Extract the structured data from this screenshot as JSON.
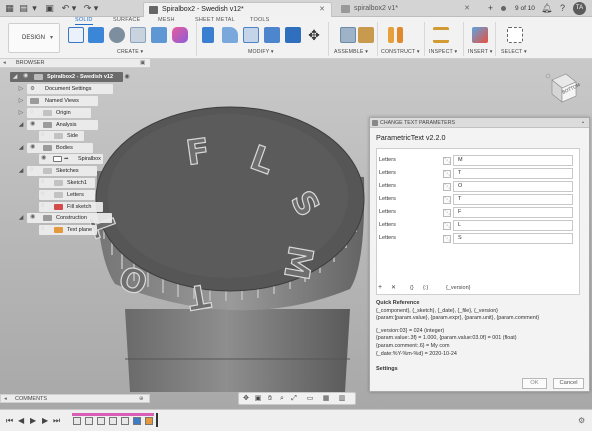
{
  "window": {
    "active_tab": "Spiralbox2 - Swedish v12*",
    "inactive_tab": "spiralbox2 v1*",
    "job_status": "9 of 10",
    "user_initials": "TA"
  },
  "ribbon": {
    "tabs": [
      "SOLID",
      "SURFACE",
      "MESH",
      "SHEET METAL",
      "TOOLS"
    ],
    "workspace": "DESIGN",
    "groups": [
      "CREATE",
      "MODIFY",
      "ASSEMBLE",
      "CONSTRUCT",
      "INSPECT",
      "INSERT",
      "SELECT"
    ]
  },
  "browser": {
    "title": "BROWSER",
    "items": [
      {
        "label": "Spiralbox2 - Swedish v12"
      },
      {
        "label": "Document Settings"
      },
      {
        "label": "Named Views"
      },
      {
        "label": "Origin"
      },
      {
        "label": "Analysis"
      },
      {
        "label": "Side"
      },
      {
        "label": "Bodies"
      },
      {
        "label": "Spiralbox"
      },
      {
        "label": "Sketches"
      },
      {
        "label": "Sketch1"
      },
      {
        "label": "Letters"
      },
      {
        "label": "Fill sketch"
      },
      {
        "label": "Construction"
      },
      {
        "label": "Text plane"
      }
    ]
  },
  "dialog": {
    "header": "CHANGE TEXT PARAMETERS",
    "title": "ParametricText v2.2.0",
    "rows": [
      {
        "label": "Letters",
        "value": "M"
      },
      {
        "label": "Letters",
        "value": "T"
      },
      {
        "label": "Letters",
        "value": "O"
      },
      {
        "label": "Letters",
        "value": "T"
      },
      {
        "label": "Letters",
        "value": "F"
      },
      {
        "label": "Letters",
        "value": "L"
      },
      {
        "label": "Letters",
        "value": "S"
      }
    ],
    "tools": {
      "add": "+",
      "remove": "✕",
      "braces1": "{}",
      "braces2": "{:}",
      "version_token": "{_version}"
    },
    "quick_reference": {
      "heading": "Quick Reference",
      "lines": [
        "{_component}, {_sketch}, {_date}, {_file}, {_version}",
        "{param:[param.value}, {param.expr}, {param.unit}, {param.comment}",
        "",
        "{_version:03} = 024 (integer)",
        "{param.value:.3f} = 1.000, {param.value:03.0f} = 001 (float)",
        "{param.comment:.6} = My com",
        "{_date:%Y-%m-%d} = 2020-10-24"
      ]
    },
    "settings_label": "Settings",
    "ok_label": "OK",
    "cancel_label": "Cancel"
  },
  "comments_label": "COMMENTS",
  "model_letters": [
    "F",
    "L",
    "S",
    "M",
    "T",
    "O",
    "T"
  ],
  "viewcube_label": "BOTTOM"
}
